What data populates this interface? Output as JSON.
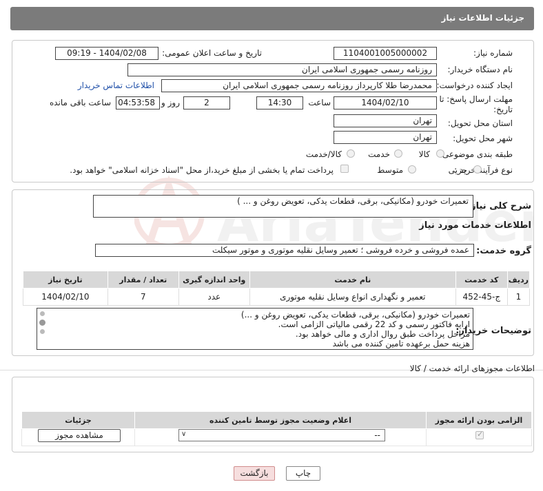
{
  "header": {
    "title": "جزئیات اطلاعات نیاز"
  },
  "fields": {
    "need_number_label": "شماره نیاز:",
    "need_number": "1104001005000002",
    "announce_label": "تاریخ و ساعت اعلان عمومی:",
    "announce_value": "1404/02/08 - 09:19",
    "buyer_org_label": "نام دستگاه خریدار:",
    "buyer_org": "روزنامه رسمی جمهوری اسلامی ایران",
    "creator_label": "ایجاد کننده درخواست:",
    "creator": "محمدرضا طلا کارپرداز روزنامه رسمی جمهوری اسلامی ایران",
    "buyer_contact_link": "اطلاعات تماس خریدار",
    "deadline_label_1": "مهلت ارسال پاسخ: تا",
    "deadline_label_2": "تاریخ:",
    "deadline_date": "1404/02/10",
    "time_label": "ساعت",
    "deadline_time": "14:30",
    "days_value": "2",
    "days_label": "روز و",
    "remaining_time": "04:53:58",
    "remaining_label": "ساعت باقی مانده",
    "province_label": "استان محل تحویل:",
    "province": "تهران",
    "city_label": "شهر محل تحویل:",
    "city": "تهران",
    "category_label": "طبقه بندی موضوعی:",
    "category_options": [
      "کالا",
      "خدمت",
      "کالا/خدمت"
    ],
    "process_label": "نوع فرآیند خرید :",
    "process_options": [
      "جزیی",
      "متوسط"
    ],
    "payment_note": "پرداخت تمام یا بخشی از مبلغ خرید،از محل \"اسناد خزانه اسلامی\" خواهد بود."
  },
  "summary": {
    "label": "شرح کلی نیاز:",
    "value": "تعمیرات خودرو (مکانیکی، برقی، قطعات یدکی، تعویض روغن و ... )"
  },
  "services": {
    "title": "اطلاعات خدمات مورد نیاز",
    "group_label": "گروه خدمت:",
    "group_value": "عمده فروشی و خرده فروشی ؛ تعمیر وسایل نقلیه موتوری و موتور سیکلت",
    "table": {
      "headers": [
        "ردیف",
        "کد خدمت",
        "نام خدمت",
        "واحد اندازه گیری",
        "تعداد / مقدار",
        "تاریخ نیاز"
      ],
      "rows": [
        [
          "1",
          "ج-45-452",
          "تعمیر و نگهداری انواع وسایل نقلیه موتوری",
          "عدد",
          "7",
          "1404/02/10"
        ]
      ]
    }
  },
  "buyer_notes": {
    "label": "توضیحات خریدار:",
    "lines": [
      "تعمیرات خودرو (مکانیکی، برقی، قطعات یدکی، تعویض روغن و ...)",
      "ارایه فاکتور رسمی و کد 22 رقمی مالیاتی الزامی است.",
      "مراحل پرداخت طبق روال اداری و مالی خواهد بود.",
      "هزینه حمل برعهده تامین کننده می باشد"
    ]
  },
  "permits": {
    "title": "اطلاعات مجوزهای ارائه خدمت / کالا",
    "headers": [
      "الزامی بودن ارائه مجوز",
      "اعلام وضعیت مجوز توسط تامین کننده",
      "جزئیات"
    ],
    "select_value": "--",
    "view_button": "مشاهده مجوز"
  },
  "footer": {
    "print_button": "چاپ",
    "back_button": "بازگشت"
  },
  "watermark": "AriaTender.net",
  "colors": {
    "header_bg": "#7b7b7b",
    "link": "#1f4fa8",
    "back_button_bg": "#f6dede"
  }
}
